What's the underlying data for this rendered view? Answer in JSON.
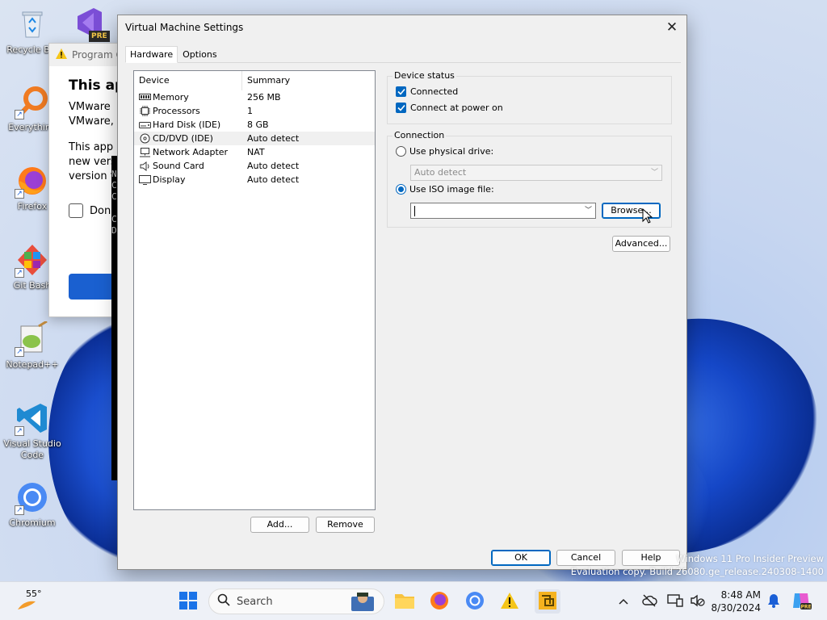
{
  "desktop": {
    "icons": [
      {
        "label": "Recycle Bin",
        "icon": "recycle-bin-icon"
      },
      {
        "label": "Everything",
        "icon": "everything-search-icon"
      },
      {
        "label": "Firefox",
        "icon": "firefox-icon"
      },
      {
        "label": "Git Bash",
        "icon": "git-bash-icon"
      },
      {
        "label": "Notepad++",
        "icon": "notepad-plus-plus-icon"
      },
      {
        "label": "Visual Studio Code",
        "icon": "vscode-icon"
      },
      {
        "label": "Chromium",
        "icon": "chromium-icon"
      }
    ],
    "vs_badge": "PRE"
  },
  "background_window": {
    "title": "Program C",
    "heading": "This app",
    "line1": "VMware",
    "line2": "VMware,",
    "line3": "This app",
    "line4": "new vers",
    "line5": "version t",
    "checkbox_label": "Don"
  },
  "console_text": [
    "N",
    "C",
    "C",
    "",
    "C",
    "D"
  ],
  "dialog": {
    "title": "Virtual Machine Settings",
    "tabs": [
      "Hardware",
      "Options"
    ],
    "device_list": {
      "headers": [
        "Device",
        "Summary"
      ],
      "rows": [
        {
          "device": "Memory",
          "summary": "256 MB",
          "icon": "memory-icon"
        },
        {
          "device": "Processors",
          "summary": "1",
          "icon": "processor-icon"
        },
        {
          "device": "Hard Disk (IDE)",
          "summary": "8 GB",
          "icon": "hard-disk-icon"
        },
        {
          "device": "CD/DVD (IDE)",
          "summary": "Auto detect",
          "icon": "cd-dvd-icon"
        },
        {
          "device": "Network Adapter",
          "summary": "NAT",
          "icon": "network-adapter-icon"
        },
        {
          "device": "Sound Card",
          "summary": "Auto detect",
          "icon": "sound-card-icon"
        },
        {
          "device": "Display",
          "summary": "Auto detect",
          "icon": "display-icon"
        }
      ]
    },
    "add_label": "Add...",
    "remove_label": "Remove",
    "device_status": {
      "legend": "Device status",
      "connected": "Connected",
      "connect_at_power_on": "Connect at power on"
    },
    "connection": {
      "legend": "Connection",
      "use_physical": "Use physical drive:",
      "physical_value": "Auto detect",
      "use_iso": "Use ISO image file:",
      "iso_value": "",
      "browse_label": "Browse..."
    },
    "advanced_label": "Advanced...",
    "ok_label": "OK",
    "cancel_label": "Cancel",
    "help_label": "Help"
  },
  "watermark": {
    "line1": "Windows 11 Pro Insider Preview",
    "line2": "Evaluation copy. Build 26080.ge_release.240308-1400"
  },
  "taskbar": {
    "temperature": "55°",
    "search_placeholder": "Search",
    "time": "8:48 AM",
    "date": "8/30/2024"
  },
  "colors": {
    "accent": "#0067c0",
    "taskbar_bg": "#eef1f7",
    "dialog_bg": "#f0f0f0"
  }
}
